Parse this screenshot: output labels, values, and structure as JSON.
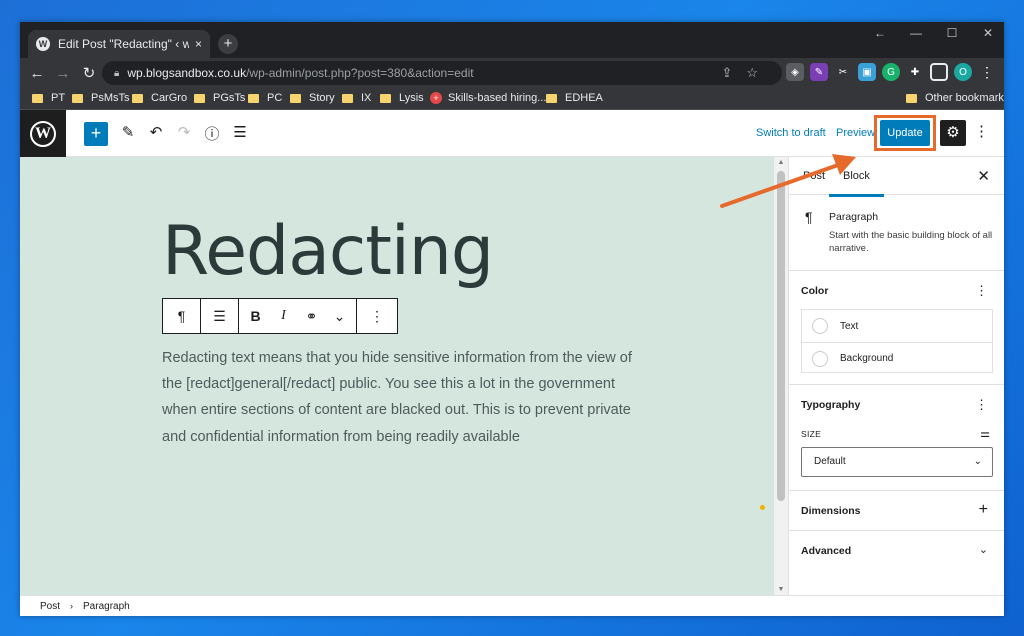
{
  "browser": {
    "tab_title": "Edit Post \"Redacting\" ‹ wp.blogsandbox.co.uk — WordPress",
    "tab_close": "×",
    "new_tab": "+",
    "url_host": "wp.blogsandbox.co.uk",
    "url_path": "/wp-admin/post.php?post=380&action=edit",
    "window_controls": [
      "←",
      "—",
      "☐",
      "✕"
    ],
    "profile_initial": "O"
  },
  "bookmarks": {
    "items": [
      "PT",
      "PsMsTs",
      "CarGro",
      "PGsTs",
      "PC",
      "Story",
      "IX",
      "Lysis",
      "Skills-based hiring...",
      "EDHEA"
    ],
    "other": "Other bookmarks"
  },
  "editor_toolbar": {
    "switch_to_draft": "Switch to draft",
    "preview": "Preview",
    "update": "Update"
  },
  "post": {
    "title": "Redacting",
    "paragraph": "Redacting text means that you hide sensitive information from the view of the [redact]general[/redact] public. You see this a lot in the government when entire sections of content are blacked out. This is to prevent private and confidential information from being readily available"
  },
  "block_toolbar": {
    "paragraph": "¶",
    "align": "☰",
    "bold": "B",
    "italic": "I",
    "link": "⚭",
    "more_format": "⌄",
    "options": "⋮"
  },
  "sidebar": {
    "tabs": [
      "Post",
      "Block"
    ],
    "active_tab": "Block",
    "block_card": {
      "name": "Paragraph",
      "description": "Start with the basic building block of all narrative."
    },
    "color": {
      "title": "Color",
      "items": [
        "Text",
        "Background"
      ]
    },
    "typography": {
      "title": "Typography",
      "size_label": "SIZE",
      "size_value": "Default"
    },
    "dimensions": "Dimensions",
    "advanced": "Advanced"
  },
  "breadcrumb": [
    "Post",
    "Paragraph"
  ],
  "colors": {
    "accent": "#007cba",
    "highlight": "#e66a2c",
    "canvas_bg": "#d5e6df"
  }
}
